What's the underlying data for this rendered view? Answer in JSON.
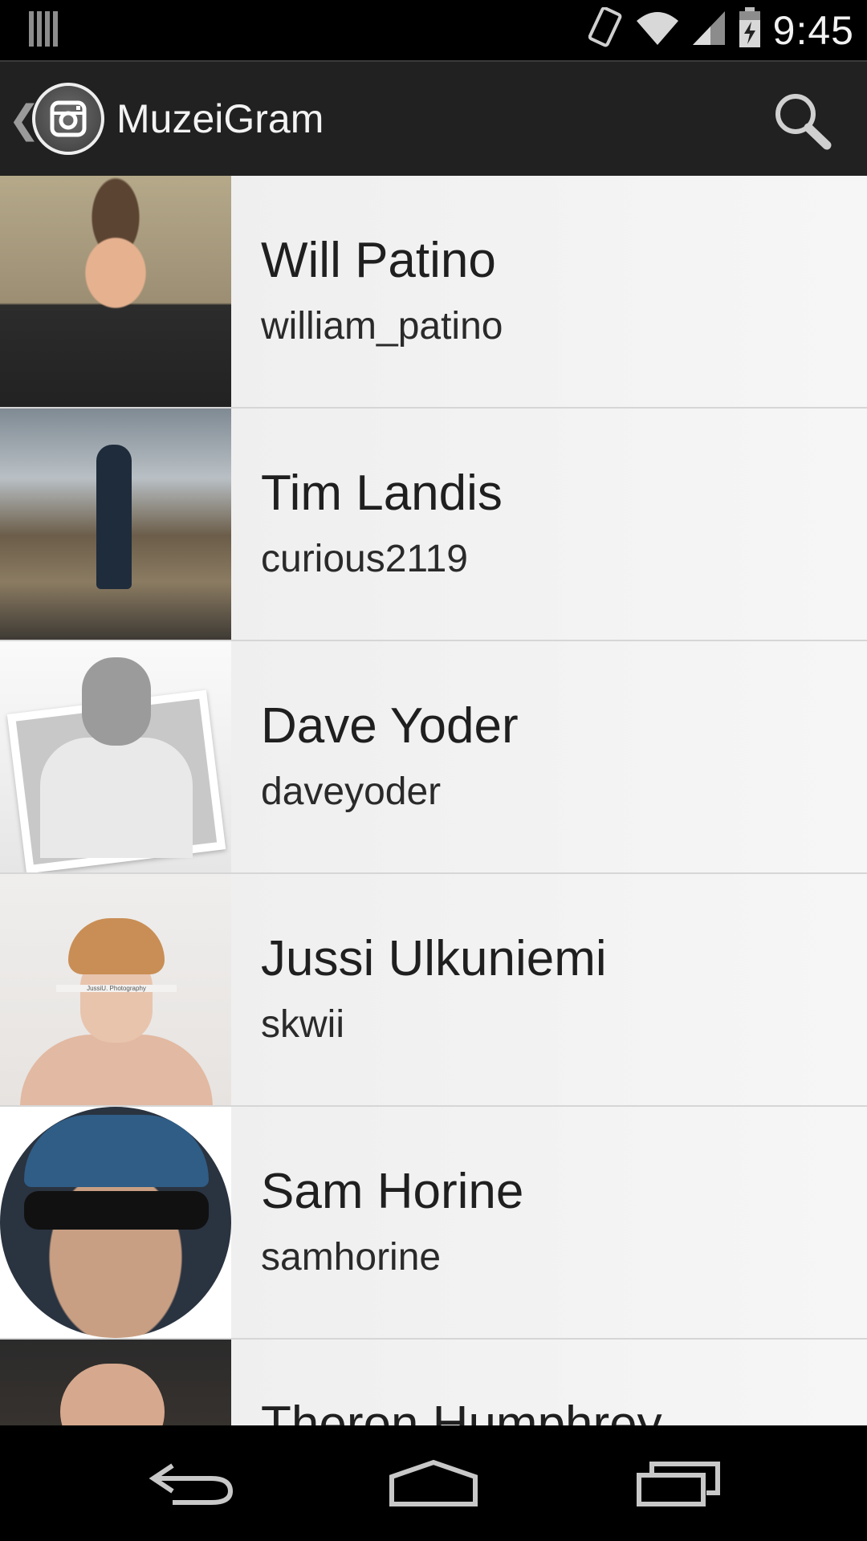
{
  "status_bar": {
    "time": "9:45",
    "icons": [
      "notification-bars-icon",
      "screen-rotate-icon",
      "wifi-icon",
      "cell-signal-icon",
      "battery-charging-icon"
    ]
  },
  "action_bar": {
    "title": "MuzeiGram",
    "up_icon": "chevron-left-icon",
    "app_icon": "instagram-camera-icon",
    "search_icon": "search-icon"
  },
  "users": [
    {
      "name": "Will Patino",
      "username": "william_patino"
    },
    {
      "name": "Tim Landis",
      "username": "curious2119"
    },
    {
      "name": "Dave Yoder",
      "username": "daveyoder"
    },
    {
      "name": "Jussi Ulkuniemi",
      "username": "skwii"
    },
    {
      "name": "Sam Horine",
      "username": "samhorine"
    },
    {
      "name": "Theron Humphrey",
      "username": ""
    }
  ],
  "thumb_caption": "JussiU. Photography",
  "nav_bar": {
    "back_icon": "back-arrow-icon",
    "home_icon": "home-icon",
    "recents_icon": "recent-apps-icon"
  },
  "colors": {
    "action_bar_bg": "#212121",
    "list_bg": "#f2f2f2",
    "divider": "#d6d6d6"
  }
}
